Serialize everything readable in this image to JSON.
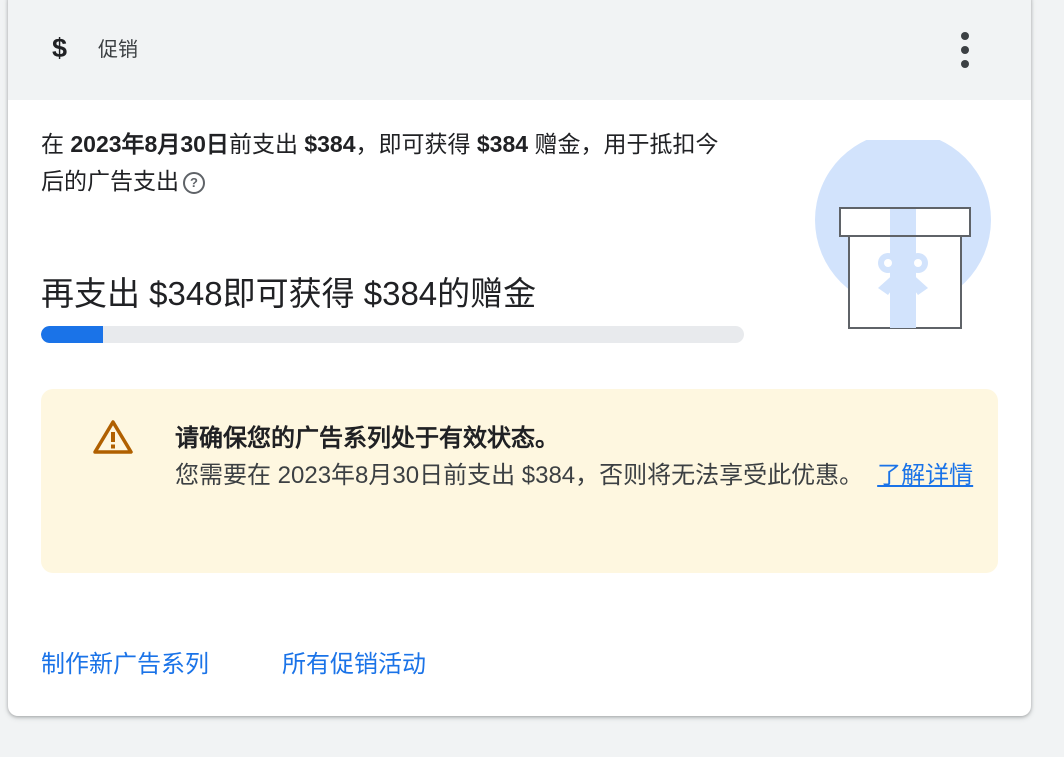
{
  "header": {
    "icon": "dollar-icon",
    "icon_glyph": "$",
    "title": "促销",
    "more_icon": "more-vert-icon"
  },
  "offer": {
    "prefix": "在 ",
    "deadline": "2023年8月30日",
    "middle": "前支出 ",
    "spend_amount": "$384",
    "middle2": "，即可获得 ",
    "credit_amount": "$384",
    "suffix": " 赠金，用于抵扣今后的广告支出",
    "help_icon_glyph": "?"
  },
  "progress": {
    "heading": "再支出 $348即可获得 $384的赠金",
    "fraction": 0.0885,
    "fill_color": "#1a73e8",
    "track_color": "#e8eaed"
  },
  "illustration": {
    "icon": "gift-icon",
    "circle_color": "#d2e3fc"
  },
  "warning": {
    "icon": "warning-icon",
    "title": "请确保您的广告系列处于有效状态。",
    "body": "您需要在 2023年8月30日前支出 $384，否则将无法享受此优惠。",
    "learn_more": "了解详情",
    "background": "#fef7e0",
    "icon_color": "#b06000"
  },
  "footer": {
    "create_campaign": "制作新广告系列",
    "all_promotions": "所有促销活动"
  }
}
